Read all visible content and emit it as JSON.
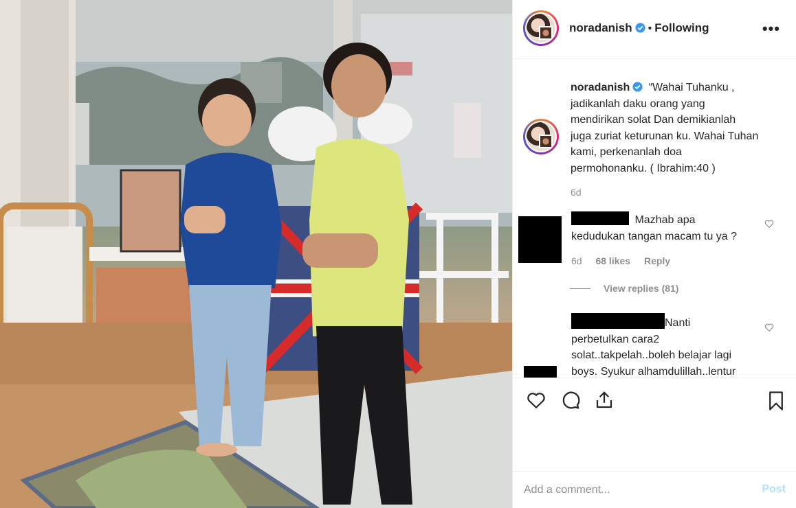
{
  "post": {
    "username": "noradanish",
    "following_label": "Following",
    "separator": "•",
    "more_label": "•••"
  },
  "caption": {
    "username": "noradanish",
    "text_lines": [
      "“Wahai Tuhanku ,",
      "jadikanlah daku orang yang",
      "mendirikan solat Dan demikianlah",
      "juga zuriat keturunan ku. Wahai Tuhan",
      "kami, perkenanlah doa",
      "permohonanku. ( Ibrahim:40 )"
    ],
    "time": "6d"
  },
  "comments": [
    {
      "text_lines": [
        "Mazhab apa",
        "kedudukan tangan macam tu ya ?"
      ],
      "time": "6d",
      "likes": "68 likes",
      "reply_label": "Reply",
      "view_replies": "View replies (81)"
    },
    {
      "text_lines": [
        "Nanti",
        "perbetulkan cara2",
        "solat..takpelah..boleh belajar lagi",
        "boys. Syukur alhamdulillah..lentur"
      ]
    }
  ],
  "actions": {
    "icons": [
      "heart-icon",
      "comment-icon",
      "share-icon",
      "bookmark-icon"
    ]
  },
  "add_comment": {
    "placeholder": "Add a comment...",
    "post_label": "Post"
  },
  "colors": {
    "text": "#262626",
    "muted": "#8e8e8e",
    "verified": "#3897f0",
    "post_disabled": "#b2dffc",
    "border": "#efefef"
  }
}
